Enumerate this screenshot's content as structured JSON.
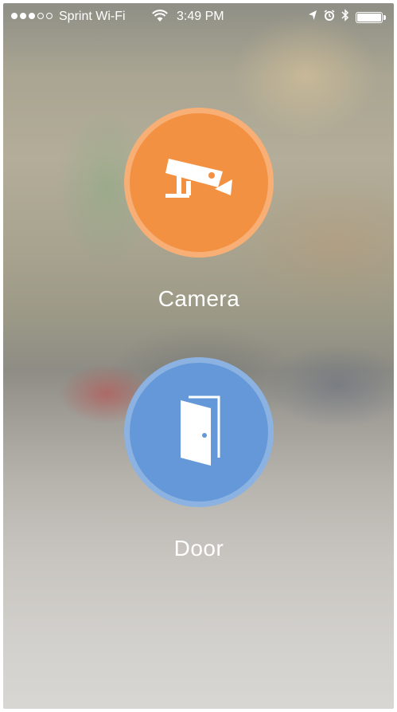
{
  "status_bar": {
    "carrier": "Sprint Wi-Fi",
    "time": "3:49 PM",
    "signal_bars_filled": 3,
    "signal_bars_total": 5,
    "icons": [
      "signal-dots-icon",
      "wifi-icon",
      "location-arrow-icon",
      "alarm-icon",
      "bluetooth-icon",
      "battery-icon"
    ],
    "battery_level": 1.0
  },
  "tiles": [
    {
      "label": "Camera",
      "icon": "security-camera-icon",
      "color": "#f39142"
    },
    {
      "label": "Door",
      "icon": "door-icon",
      "color": "#6498d8"
    }
  ]
}
